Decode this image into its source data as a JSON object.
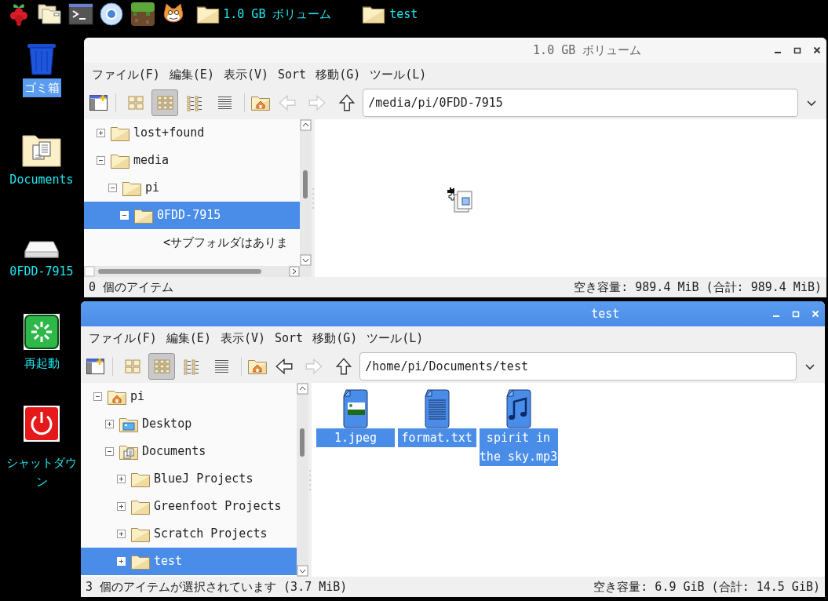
{
  "taskbar": {
    "launchers": [
      {
        "kind": "raspberry"
      },
      {
        "kind": "file-manager"
      },
      {
        "kind": "terminal"
      },
      {
        "kind": "browser"
      },
      {
        "kind": "block-game"
      },
      {
        "kind": "cat"
      }
    ],
    "tasks": [
      {
        "title": "1.0 GB ボリューム"
      },
      {
        "title": "test"
      }
    ]
  },
  "desktop_icons": [
    {
      "label": "ゴミ箱",
      "kind": "trash",
      "selected": true
    },
    {
      "label": "Documents",
      "kind": "documents",
      "selected": false
    },
    {
      "label": "0FDD-7915",
      "kind": "drive",
      "selected": false
    },
    {
      "label": "再起動",
      "kind": "restart",
      "selected": false
    },
    {
      "label": "シャットダウン",
      "kind": "shutdown",
      "selected": false
    }
  ],
  "windows": [
    {
      "title": "1.0 GB ボリューム",
      "active": false,
      "menu": [
        "ファイル(F)",
        "編集(E)",
        "表示(V)",
        "Sort",
        "移動(G)",
        "ツール(L)"
      ],
      "view_modes": [
        {
          "kind": "icons",
          "selected": false
        },
        {
          "kind": "compact",
          "selected": true
        },
        {
          "kind": "short",
          "selected": false
        },
        {
          "kind": "detailed",
          "selected": false
        }
      ],
      "nav": [
        {
          "kind": "back",
          "disabled": true
        },
        {
          "kind": "forward",
          "disabled": true
        },
        {
          "kind": "up",
          "disabled": false
        }
      ],
      "path": "/media/pi/0FDD-7915",
      "tree": [
        {
          "label": "lost+found",
          "kind": "folder",
          "expanded": false,
          "selected": false
        },
        {
          "label": "media",
          "kind": "folder",
          "expanded": true,
          "selected": false,
          "children": [
            {
              "label": "pi",
              "kind": "folder",
              "expanded": true,
              "selected": false,
              "children": [
                {
                  "label": "0FDD-7915",
                  "kind": "folder",
                  "expanded": true,
                  "selected": true,
                  "children": [
                    {
                      "label": "<サブフォルダはありま",
                      "kind": "note",
                      "selected": false
                    }
                  ]
                }
              ]
            }
          ]
        }
      ],
      "horizontal_scrollbar": true,
      "drag_cursor": true,
      "status_left": "0 個のアイテム",
      "status_right": "空き容量: 989.4 MiB (合計: 989.4 MiB)"
    },
    {
      "title": "test",
      "active": true,
      "menu": [
        "ファイル(F)",
        "編集(E)",
        "表示(V)",
        "Sort",
        "移動(G)",
        "ツール(L)"
      ],
      "view_modes": [
        {
          "kind": "icons",
          "selected": false
        },
        {
          "kind": "compact",
          "selected": true
        },
        {
          "kind": "short",
          "selected": false
        },
        {
          "kind": "detailed",
          "selected": false
        }
      ],
      "nav": [
        {
          "kind": "back",
          "disabled": false
        },
        {
          "kind": "forward",
          "disabled": true
        },
        {
          "kind": "up",
          "disabled": false
        }
      ],
      "path": "/home/pi/Documents/test",
      "tree": [
        {
          "label": "pi",
          "kind": "home",
          "expanded": true,
          "selected": false,
          "children": [
            {
              "label": "Desktop",
              "kind": "desktop",
              "expanded": false,
              "selected": false
            },
            {
              "label": "Documents",
              "kind": "documents",
              "expanded": true,
              "selected": false,
              "children": [
                {
                  "label": "BlueJ Projects",
                  "kind": "folder",
                  "expanded": false,
                  "selected": false
                },
                {
                  "label": "Greenfoot Projects",
                  "kind": "folder",
                  "expanded": false,
                  "selected": false
                },
                {
                  "label": "Scratch Projects",
                  "kind": "folder",
                  "expanded": false,
                  "selected": false
                },
                {
                  "label": "test",
                  "kind": "folder",
                  "expanded": false,
                  "selected": true
                }
              ]
            }
          ]
        }
      ],
      "horizontal_scrollbar": false,
      "drag_cursor": false,
      "files": [
        {
          "name": "1.jpeg",
          "kind": "image",
          "selected": true
        },
        {
          "name": "format.txt",
          "kind": "text",
          "selected": true
        },
        {
          "name": "spirit in the sky.mp3",
          "kind": "audio",
          "selected": true
        }
      ],
      "status_left": "3 個のアイテムが選択されています (3.7 MiB)",
      "status_right": "空き容量: 6.9 GiB (合計: 14.5 GiB)"
    }
  ]
}
